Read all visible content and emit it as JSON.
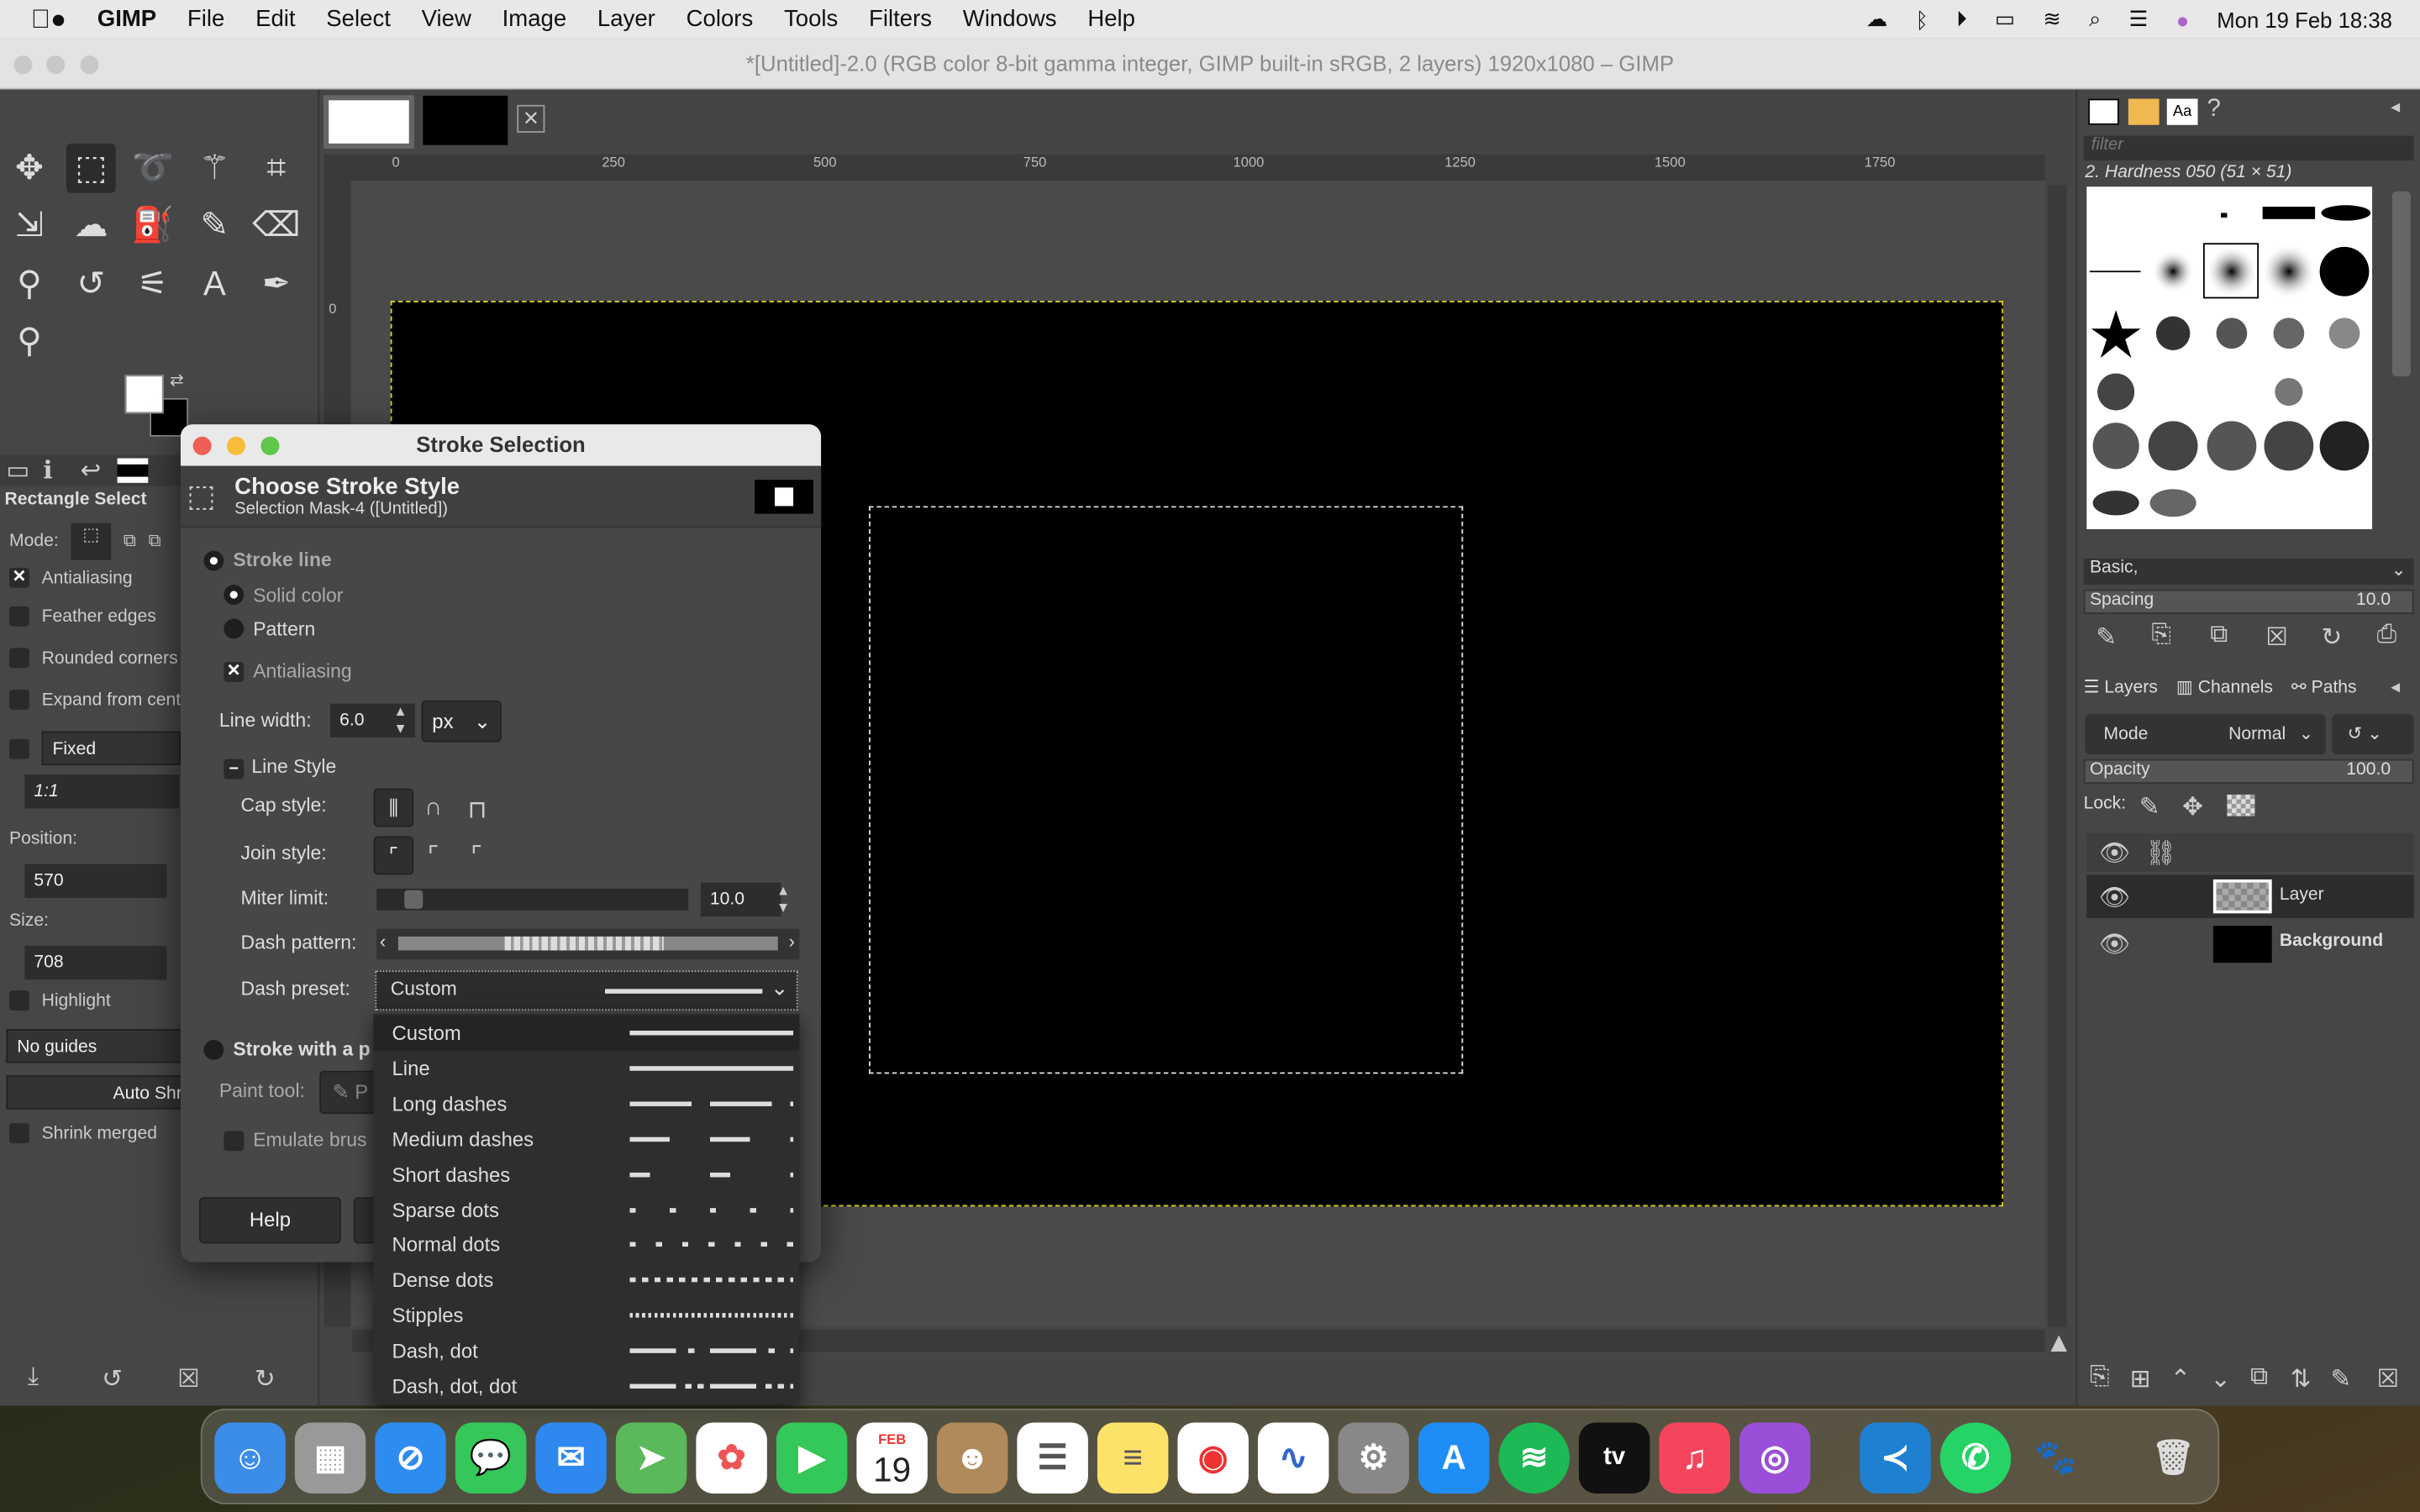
{
  "menubar": {
    "app": "GIMP",
    "items": [
      "File",
      "Edit",
      "Select",
      "View",
      "Image",
      "Layer",
      "Colors",
      "Tools",
      "Filters",
      "Windows",
      "Help"
    ],
    "clock": "Mon 19 Feb  18:38"
  },
  "window": {
    "title": "*[Untitled]-2.0 (RGB color 8-bit gamma integer, GIMP built-in sRGB, 2 layers) 1920x1080 – GIMP"
  },
  "ruler": {
    "ticks": [
      "0",
      "250",
      "500",
      "750",
      "1000",
      "1250",
      "1500",
      "1750"
    ],
    "left_tick": "0"
  },
  "tool_options": {
    "title": "Rectangle Select",
    "mode_label": "Mode:",
    "antialiasing": "Antialiasing",
    "feather": "Feather edges",
    "rounded": "Rounded corners",
    "expand": "Expand from cente",
    "fixed": "Fixed",
    "ratio": "1:1",
    "position_label": "Position:",
    "position_x": "570",
    "size_label": "Size:",
    "size_w": "708",
    "highlight": "Highlight",
    "guides": "No guides",
    "auto_shrink": "Auto Shr",
    "shrink_merged": "Shrink merged"
  },
  "dialog": {
    "title": "Stroke Selection",
    "heading": "Choose Stroke Style",
    "subheading": "Selection Mask-4 ([Untitled])",
    "stroke_line": "Stroke line",
    "solid_color": "Solid color",
    "pattern": "Pattern",
    "antialiasing": "Antialiasing",
    "line_width_label": "Line width:",
    "line_width": "6.0",
    "unit": "px",
    "line_style": "Line Style",
    "cap_style": "Cap style:",
    "join_style": "Join style:",
    "miter_label": "Miter limit:",
    "miter_value": "10.0",
    "dash_pattern": "Dash pattern:",
    "dash_preset_label": "Dash preset:",
    "dash_preset_value": "Custom",
    "stroke_with": "Stroke with a p",
    "paint_tool_label": "Paint tool:",
    "paint_tool_value": "P",
    "emulate": "Emulate brus",
    "help": "Help"
  },
  "dash_presets": [
    "Custom",
    "Line",
    "Long dashes",
    "Medium dashes",
    "Short dashes",
    "Sparse dots",
    "Normal dots",
    "Dense dots",
    "Stipples",
    "Dash, dot",
    "Dash, dot, dot"
  ],
  "brushes": {
    "filter_placeholder": "filter",
    "selected": "2. Hardness 050 (51 × 51)",
    "tag": "Basic,",
    "spacing_label": "Spacing",
    "spacing": "10.0"
  },
  "layers": {
    "tabs": [
      "Layers",
      "Channels",
      "Paths"
    ],
    "mode_label": "Mode",
    "mode": "Normal",
    "opacity_label": "Opacity",
    "opacity": "100.0",
    "lock_label": "Lock:",
    "items": [
      "Layer",
      "Background"
    ]
  },
  "dock": {
    "calendar_month": "FEB",
    "calendar_day": "19"
  },
  "colors": {
    "accent_selection": "#d8d020",
    "bg": "#454545"
  }
}
